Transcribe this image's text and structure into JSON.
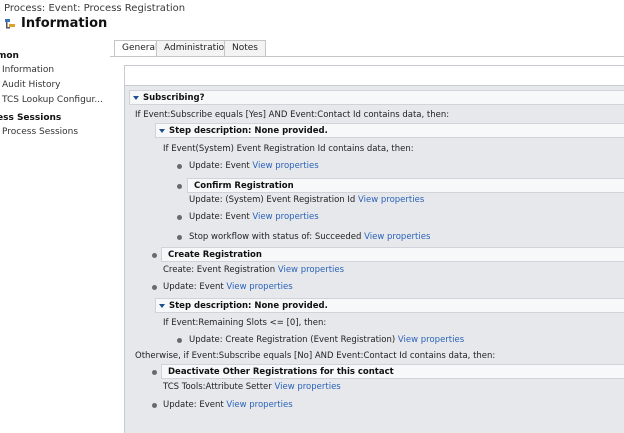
{
  "header": {
    "breadcrumb": "Process: Event: Process Registration",
    "title": "Information"
  },
  "nav": {
    "section1": "mon",
    "items1": [
      "Information",
      "Audit History",
      "TCS Lookup Configur..."
    ],
    "section2": "ess Sessions",
    "items2": [
      "Process Sessions"
    ]
  },
  "tabs": [
    "General",
    "Administration",
    "Notes"
  ],
  "workflow": {
    "subscribing": "Subscribing?",
    "cond1": "If Event:Subscribe equals [Yes] AND Event:Contact Id contains data, then:",
    "step_desc1": "Step description: None provided.",
    "cond2": "If Event(System) Event Registration Id contains data, then:",
    "update_event_1": "Update:  Event",
    "view_props": "View properties",
    "confirm_reg": "Confirm Registration",
    "update_sys_reg": "Update:  (System) Event Registration Id",
    "update_event_2": "Update:  Event",
    "stop_wf": "Stop workflow with status of:  Succeeded",
    "create_reg": "Create Registration",
    "create_event_reg": "Create:  Event Registration",
    "update_event_3": "Update:  Event",
    "step_desc2": "Step description: None provided.",
    "cond3": "If Event:Remaining Slots <= [0], then:",
    "update_create_reg": "Update:  Create Registration (Event Registration)",
    "otherwise": "Otherwise, if Event:Subscribe equals [No] AND Event:Contact Id contains data, then:",
    "deactivate": "Deactivate Other Registrations for this contact",
    "tcs_tools": "TCS Tools:Attribute Setter",
    "update_event_4": "Update:  Event"
  }
}
